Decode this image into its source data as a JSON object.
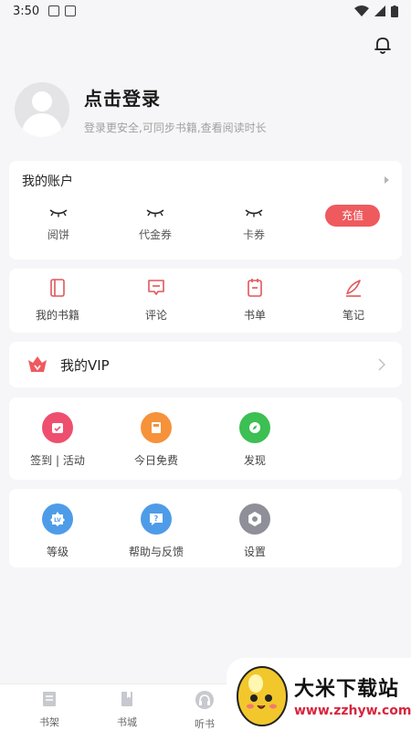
{
  "status_bar": {
    "time": "3:50"
  },
  "profile": {
    "login_title": "点击登录",
    "login_sub": "登录更安全,可同步书籍,查看阅读时长"
  },
  "account": {
    "title": "我的账户",
    "items": [
      {
        "label": "阅饼"
      },
      {
        "label": "代金券"
      },
      {
        "label": "卡券"
      }
    ],
    "recharge_label": "充值"
  },
  "books": {
    "items": [
      {
        "label": "我的书籍",
        "icon": "book-icon"
      },
      {
        "label": "评论",
        "icon": "comment-icon"
      },
      {
        "label": "书单",
        "icon": "booklist-icon"
      },
      {
        "label": "笔记",
        "icon": "note-icon"
      }
    ]
  },
  "vip": {
    "label": "我的VIP"
  },
  "quick": {
    "items": [
      {
        "label": "签到 | 活动",
        "color": "#ef4f6f"
      },
      {
        "label": "今日免费",
        "color": "#f6923a"
      },
      {
        "label": "发现",
        "color": "#3cbf53"
      }
    ]
  },
  "more": {
    "items": [
      {
        "label": "等级",
        "color": "#4e9ce8"
      },
      {
        "label": "帮助与反馈",
        "color": "#4e9ce8"
      },
      {
        "label": "设置",
        "color": "#8f8f9a"
      }
    ]
  },
  "tabbar": {
    "items": [
      {
        "label": "书架"
      },
      {
        "label": "书城"
      },
      {
        "label": "听书"
      }
    ]
  },
  "watermark": {
    "text": "大米下载站",
    "url": "www.zzhyw.com"
  },
  "colors": {
    "accent": "#ee5a5e",
    "background": "#f6f6f8"
  }
}
